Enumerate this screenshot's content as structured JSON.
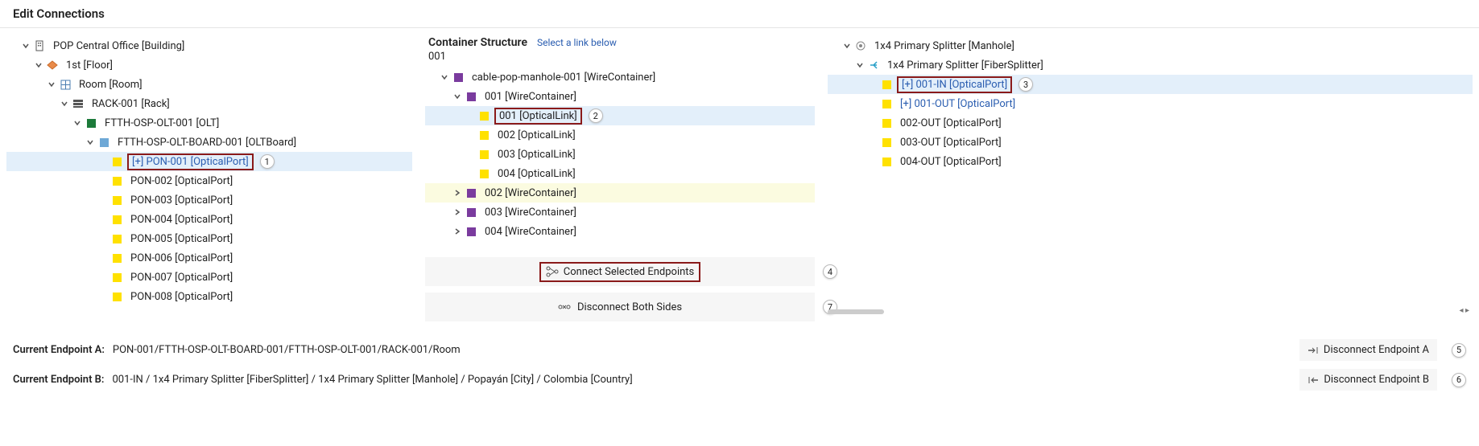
{
  "title": "Edit Connections",
  "left_tree": {
    "n0": {
      "label": "POP Central Office [Building]",
      "icon": "building"
    },
    "n1": {
      "label": "1st [Floor]",
      "icon": "floor"
    },
    "n2": {
      "label": "Room [Room]",
      "icon": "room"
    },
    "n3": {
      "label": "RACK-001 [Rack]",
      "icon": "rack"
    },
    "n4": {
      "label": "FTTH-OSP-OLT-001 [OLT]",
      "icon": "green-sq"
    },
    "n5": {
      "label": "FTTH-OSP-OLT-BOARD-001 [OLTBoard]",
      "icon": "blue-sq"
    },
    "ports": [
      {
        "label": "[+] PON-001 [OpticalPort]",
        "selected": true,
        "boxed": true,
        "badge": "1"
      },
      {
        "label": "PON-002 [OpticalPort]"
      },
      {
        "label": "PON-003 [OpticalPort]"
      },
      {
        "label": "PON-004 [OpticalPort]"
      },
      {
        "label": "PON-005 [OpticalPort]"
      },
      {
        "label": "PON-006 [OpticalPort]"
      },
      {
        "label": "PON-007 [OpticalPort]"
      },
      {
        "label": "PON-008 [OpticalPort]"
      }
    ]
  },
  "mid": {
    "title": "Container Structure",
    "subtitle": "Select a link below",
    "code": "001",
    "root": {
      "label": "cable-pop-manhole-001 [WireContainer]"
    },
    "wc001": {
      "label": "001 [WireContainer]"
    },
    "links001": [
      {
        "label": "001 [OpticalLink]",
        "boxed": true,
        "selected": true,
        "badge": "2"
      },
      {
        "label": "002 [OpticalLink]"
      },
      {
        "label": "003 [OpticalLink]"
      },
      {
        "label": "004 [OpticalLink]"
      }
    ],
    "wc_others": [
      {
        "label": "002 [WireContainer]",
        "hover": true
      },
      {
        "label": "003 [WireContainer]"
      },
      {
        "label": "004 [WireContainer]"
      }
    ],
    "connect_btn": {
      "label": "Connect Selected Endpoints",
      "badge": "4"
    },
    "disconnect_both_btn": {
      "label": "Disconnect Both Sides",
      "badge": "7"
    }
  },
  "right_tree": {
    "n0": {
      "label": "1x4 Primary Splitter [Manhole]",
      "icon": "manhole"
    },
    "n1": {
      "label": "1x4 Primary Splitter [FiberSplitter]",
      "icon": "splitter"
    },
    "ports": [
      {
        "label": "[+] 001-IN [OpticalPort]",
        "selected": true,
        "boxed": true,
        "badge": "3"
      },
      {
        "label": "[+] 001-OUT [OpticalPort]",
        "link": true
      },
      {
        "label": "002-OUT [OpticalPort]"
      },
      {
        "label": "003-OUT [OpticalPort]"
      },
      {
        "label": "004-OUT [OpticalPort]"
      }
    ]
  },
  "footer": {
    "a_label": "Current Endpoint A:",
    "a_value": "PON-001/FTTH-OSP-OLT-BOARD-001/FTTH-OSP-OLT-001/RACK-001/Room",
    "b_label": "Current Endpoint B:",
    "b_value": "001-IN / 1x4 Primary Splitter [FiberSplitter] / 1x4 Primary Splitter [Manhole] / Popayán [City] / Colombia [Country]",
    "disc_a": {
      "label": "Disconnect Endpoint A",
      "badge": "5"
    },
    "disc_b": {
      "label": "Disconnect Endpoint B",
      "badge": "6"
    }
  }
}
